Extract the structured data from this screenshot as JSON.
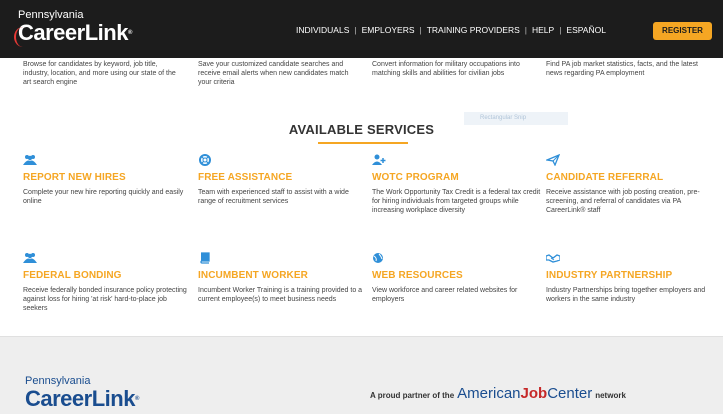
{
  "header": {
    "logo_top": "Pennsylvania",
    "logo_main": "CareerLink",
    "logo_reg": "®",
    "nav": [
      "INDIVIDUALS",
      "EMPLOYERS",
      "TRAINING PROVIDERS",
      "HELP",
      "ESPAÑOL"
    ],
    "register_label": "REGISTER"
  },
  "top_partial": [
    "Browse for candidates by keyword, job title, industry, location, and more using our state of the art search engine",
    "Save your customized candidate searches and receive email alerts when new candidates match your criteria",
    "Convert information for military occupations into matching skills and abilities for civilian jobs",
    "Find PA job market statistics, facts, and the latest news regarding PA employment"
  ],
  "section_title": "AVAILABLE SERVICES",
  "ghost_text": "Rectangular Snip",
  "services": [
    {
      "title": "REPORT NEW HIRES",
      "desc": "Complete your new hire reporting quickly and easily online",
      "icon": "people-icon"
    },
    {
      "title": "FREE ASSISTANCE",
      "desc": "Team with experienced staff to assist with a wide range of recruitment services",
      "icon": "lifebuoy-icon"
    },
    {
      "title": "WOTC PROGRAM",
      "desc": "The Work Opportunity Tax Credit is a federal tax credit for hiring individuals from targeted groups while increasing workplace diversity",
      "icon": "user-plus-icon"
    },
    {
      "title": "CANDIDATE REFERRAL",
      "desc": "Receive assistance with job posting creation, pre-screening, and referral of candidates via PA CareerLink® staff",
      "icon": "paper-plane-icon"
    },
    {
      "title": "FEDERAL BONDING",
      "desc": "Receive federally bonded insurance policy protecting against loss for hiring 'at risk' hard-to-place job seekers",
      "icon": "people-icon"
    },
    {
      "title": "INCUMBENT WORKER",
      "desc": "Incumbent Worker Training is a training provided to a current employee(s) to meet business needs",
      "icon": "book-icon"
    },
    {
      "title": "WEB RESOURCES",
      "desc": "View workforce and career related websites for employers",
      "icon": "globe-icon"
    },
    {
      "title": "INDUSTRY PARTNERSHIP",
      "desc": "Industry Partnerships bring together employers and workers in the same industry",
      "icon": "handshake-icon"
    }
  ],
  "footer": {
    "logo_top": "Pennsylvania",
    "logo_main": "CareerLink",
    "logo_reg": "®",
    "partner_prefix": "A proud partner of the",
    "ajc_american": "American",
    "ajc_job": "Job",
    "ajc_center": "Center",
    "partner_suffix": "network"
  },
  "colors": {
    "accent": "#f5a623",
    "icon_blue": "#2f8fd8",
    "header_bg": "#1c1c1c",
    "footer_bg": "#eeeeee"
  }
}
